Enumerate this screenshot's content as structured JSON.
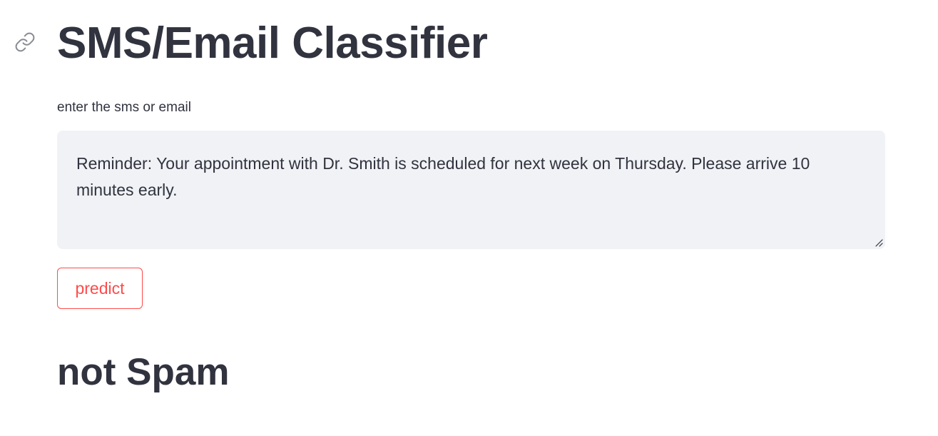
{
  "header": {
    "anchor_icon": "link-icon",
    "title": "SMS/Email Classifier"
  },
  "form": {
    "input_label": "enter the sms or email",
    "message_value": "Reminder: Your appointment with Dr. Smith is scheduled for next week on Thursday. Please arrive 10 minutes early.",
    "resize_icon": "resize-handle-icon",
    "predict_label": "predict"
  },
  "result": {
    "prediction": "not Spam"
  },
  "colors": {
    "text": "#31333f",
    "accent": "#ff4b4b",
    "input_background": "#f0f2f6",
    "icon": "#8a8c94"
  }
}
